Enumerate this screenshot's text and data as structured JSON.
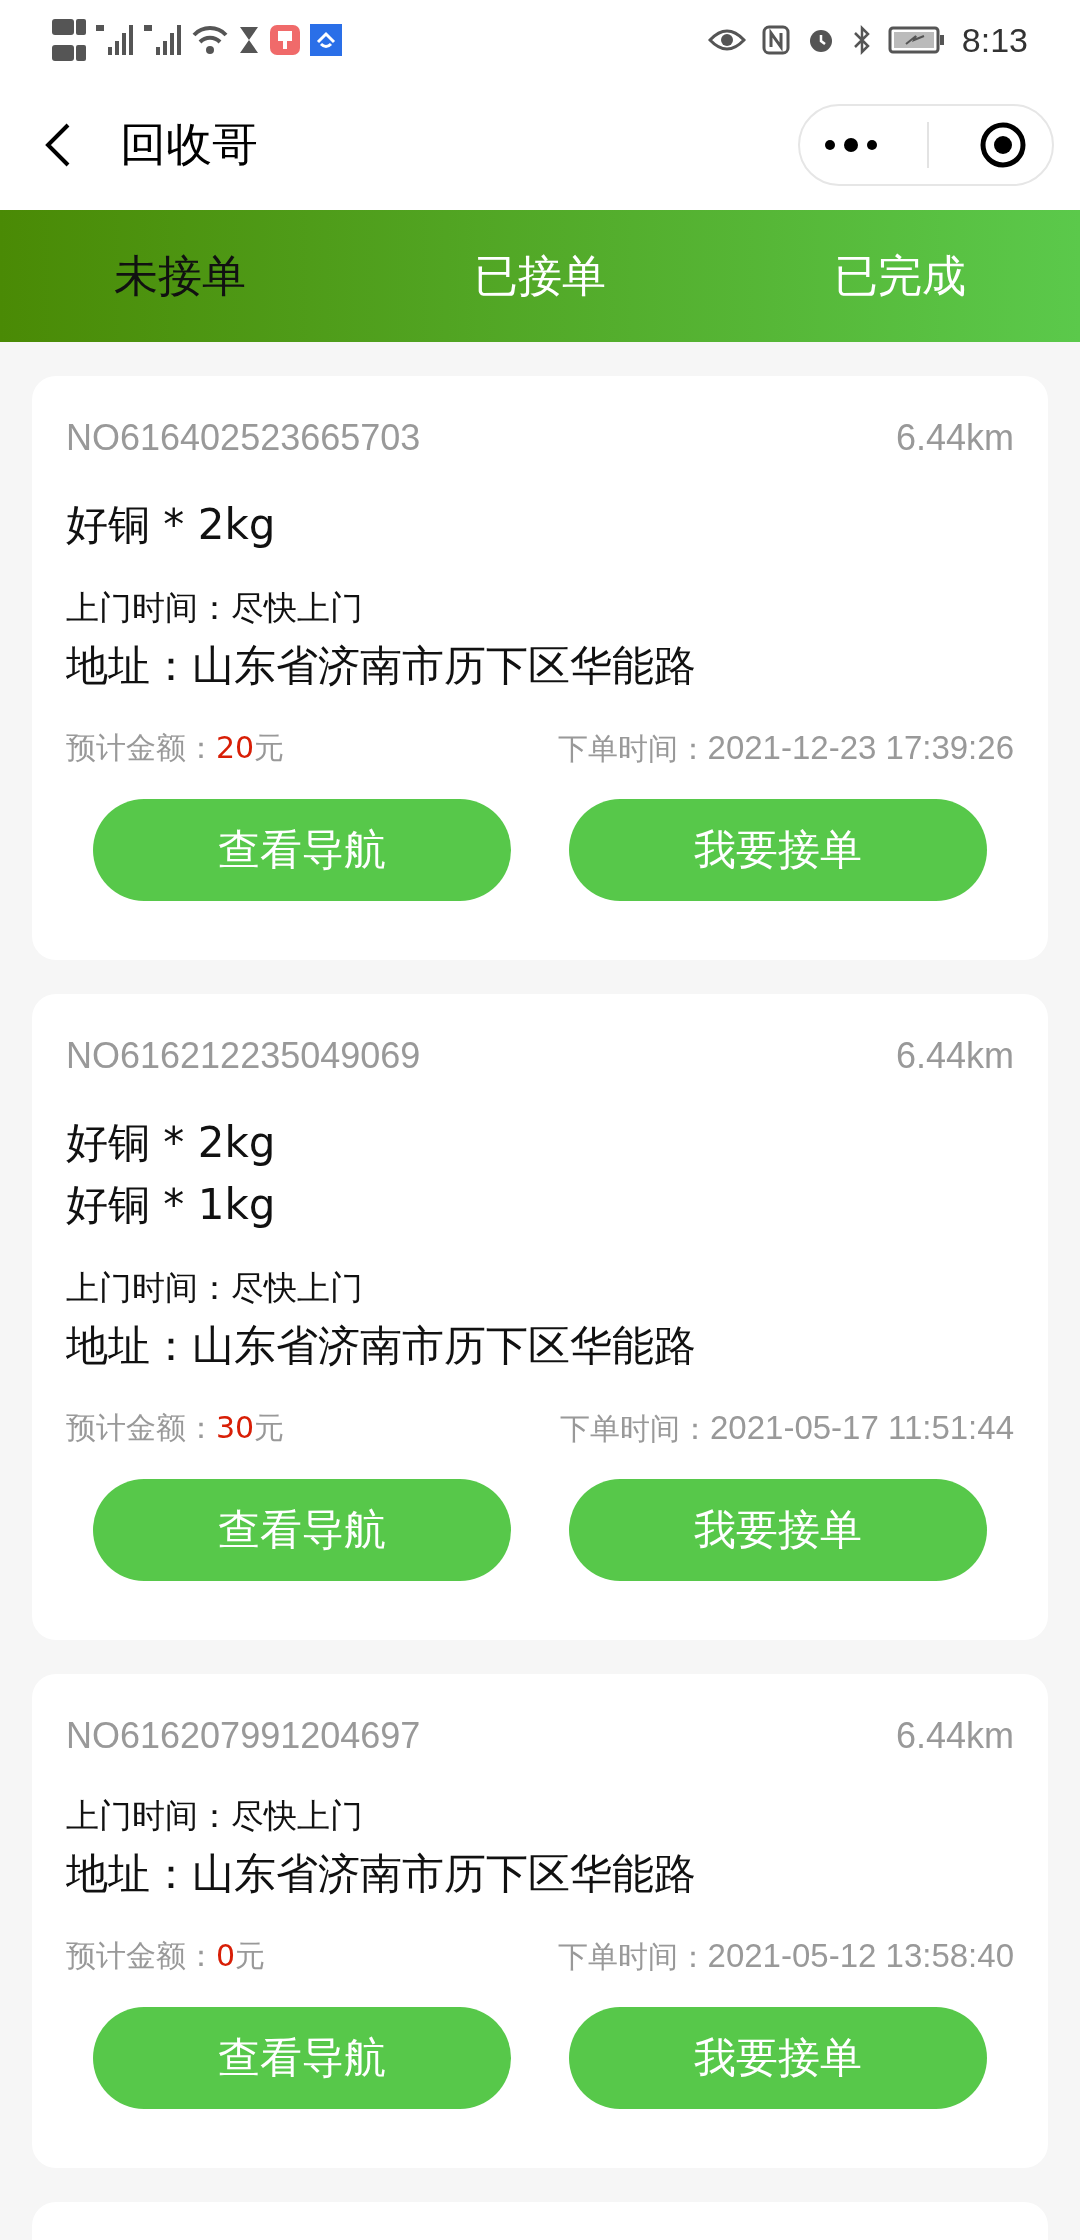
{
  "status_bar": {
    "time": "8:13"
  },
  "header": {
    "title": "回收哥"
  },
  "tabs": [
    {
      "label": "未接单",
      "selected": true
    },
    {
      "label": "已接单",
      "selected": false
    },
    {
      "label": "已完成",
      "selected": false
    }
  ],
  "orders": [
    {
      "number": "NO616402523665703",
      "distance": "6.44km",
      "items": [
        "好铜 * 2kg"
      ],
      "visit_label": "上门时间：",
      "visit_time": "尽快上门",
      "address_label": "地址：",
      "address": "山东省济南市历下区华能路",
      "amount_label": "预计金额：",
      "amount": "20",
      "amount_unit": "元",
      "order_time_label": "下单时间：",
      "order_time": "2021-12-23 17:39:26",
      "buttons": [
        "查看导航",
        "我要接单"
      ]
    },
    {
      "number": "NO616212235049069",
      "distance": "6.44km",
      "items": [
        "好铜 * 2kg",
        "好铜 * 1kg"
      ],
      "visit_label": "上门时间：",
      "visit_time": "尽快上门",
      "address_label": "地址：",
      "address": "山东省济南市历下区华能路",
      "amount_label": "预计金额：",
      "amount": "30",
      "amount_unit": "元",
      "order_time_label": "下单时间：",
      "order_time": "2021-05-17 11:51:44",
      "buttons": [
        "查看导航",
        "我要接单"
      ]
    },
    {
      "number": "NO616207991204697",
      "distance": "6.44km",
      "visit_label": "上门时间：",
      "visit_time": "尽快上门",
      "address_label": "地址：",
      "address": "山东省济南市历下区华能路",
      "amount_label": "预计金额：",
      "amount": "0",
      "amount_unit": "元",
      "order_time_label": "下单时间：",
      "order_time": "2021-05-12 13:58:40",
      "buttons": [
        "查看导航",
        "我要接单"
      ]
    }
  ]
}
